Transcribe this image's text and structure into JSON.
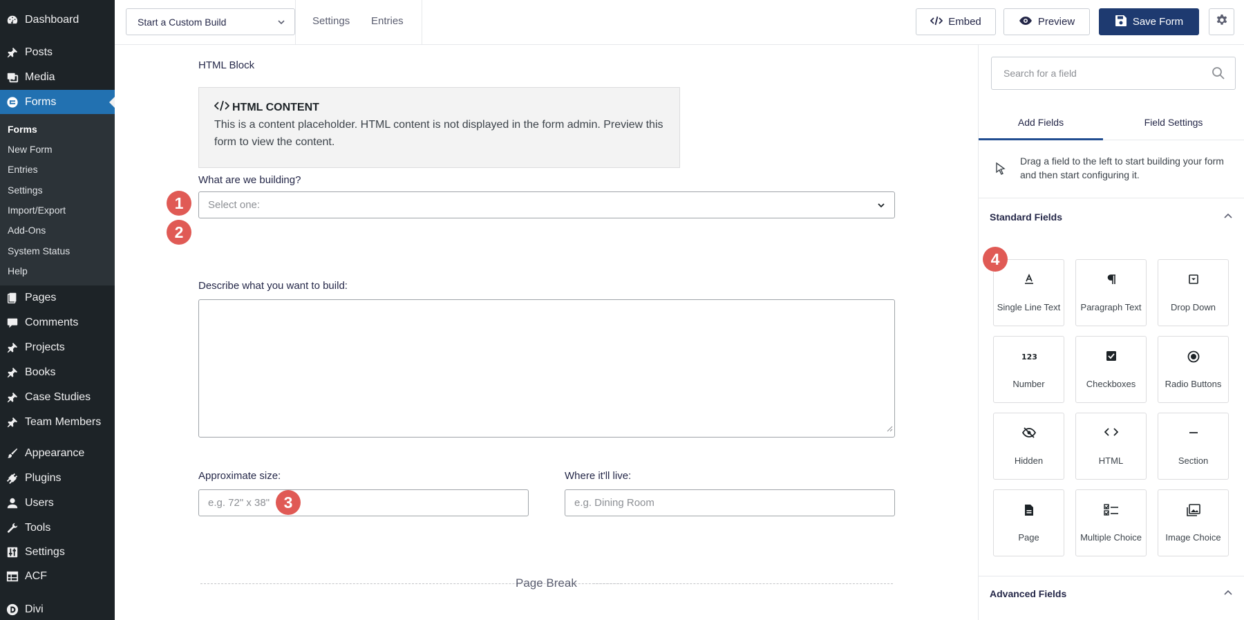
{
  "sidebar": {
    "menu_top": [
      {
        "label": "Dashboard",
        "icon": "dashboard-icon"
      },
      {
        "label": "Posts",
        "icon": "pin-icon"
      },
      {
        "label": "Media",
        "icon": "media-icon"
      },
      {
        "label": "Forms",
        "icon": "forms-icon"
      }
    ],
    "submenu": [
      "Forms",
      "New Form",
      "Entries",
      "Settings",
      "Import/Export",
      "Add-Ons",
      "System Status",
      "Help"
    ],
    "menu_mid": [
      {
        "label": "Pages",
        "icon": "pages-icon"
      },
      {
        "label": "Comments",
        "icon": "comments-icon"
      },
      {
        "label": "Projects",
        "icon": "pin-icon"
      },
      {
        "label": "Books",
        "icon": "pin-icon"
      },
      {
        "label": "Case Studies",
        "icon": "pin-icon"
      },
      {
        "label": "Team Members",
        "icon": "pin-icon"
      }
    ],
    "menu_bottom": [
      {
        "label": "Appearance",
        "icon": "brush-icon"
      },
      {
        "label": "Plugins",
        "icon": "plug-icon"
      },
      {
        "label": "Users",
        "icon": "user-icon"
      },
      {
        "label": "Tools",
        "icon": "wrench-icon"
      },
      {
        "label": "Settings",
        "icon": "sliders-icon"
      },
      {
        "label": "ACF",
        "icon": "table-icon"
      },
      {
        "label": "Divi",
        "icon": "divi-icon"
      }
    ]
  },
  "toolbar": {
    "form_name": "Start a Custom Build",
    "settings_link": "Settings",
    "entries_link": "Entries",
    "embed_label": "Embed",
    "preview_label": "Preview",
    "save_label": "Save Form"
  },
  "canvas": {
    "html_block_label": "HTML Block",
    "html_block_title": "HTML CONTENT",
    "html_block_text": "This is a content placeholder. HTML content is not displayed in the form admin. Preview this form to view the content.",
    "q1_label": "What are we building?",
    "q1_placeholder": "Select one:",
    "q2_label": "Describe what you want to build:",
    "size_label": "Approximate size:",
    "size_placeholder": "e.g. 72\" x 38\"",
    "live_label": "Where it'll live:",
    "live_placeholder": "e.g. Dining Room",
    "page_break": "Page Break",
    "badges": [
      "1",
      "2",
      "3",
      "4"
    ]
  },
  "panel": {
    "search_placeholder": "Search for a field",
    "tab_add": "Add Fields",
    "tab_settings": "Field Settings",
    "hint": "Drag a field to the left to start building your form and then start configuring it.",
    "standard_title": "Standard Fields",
    "advanced_title": "Advanced Fields",
    "fields": [
      {
        "label": "Single Line Text",
        "icon": "single-line-text-icon"
      },
      {
        "label": "Paragraph Text",
        "icon": "paragraph-icon"
      },
      {
        "label": "Drop Down",
        "icon": "dropdown-icon"
      },
      {
        "label": "Number",
        "icon": "number-icon"
      },
      {
        "label": "Checkboxes",
        "icon": "checkbox-icon"
      },
      {
        "label": "Radio Buttons",
        "icon": "radio-icon"
      },
      {
        "label": "Hidden",
        "icon": "hidden-icon"
      },
      {
        "label": "HTML",
        "icon": "code-icon"
      },
      {
        "label": "Section",
        "icon": "section-icon"
      },
      {
        "label": "Page",
        "icon": "page-icon"
      },
      {
        "label": "Multiple Choice",
        "icon": "multiple-choice-icon"
      },
      {
        "label": "Image Choice",
        "icon": "image-choice-icon"
      }
    ]
  },
  "colors": {
    "sidebar_bg": "#1d2327",
    "active_menu": "#2271b1",
    "save_button": "#1e3a70",
    "badge": "#e05a55"
  }
}
